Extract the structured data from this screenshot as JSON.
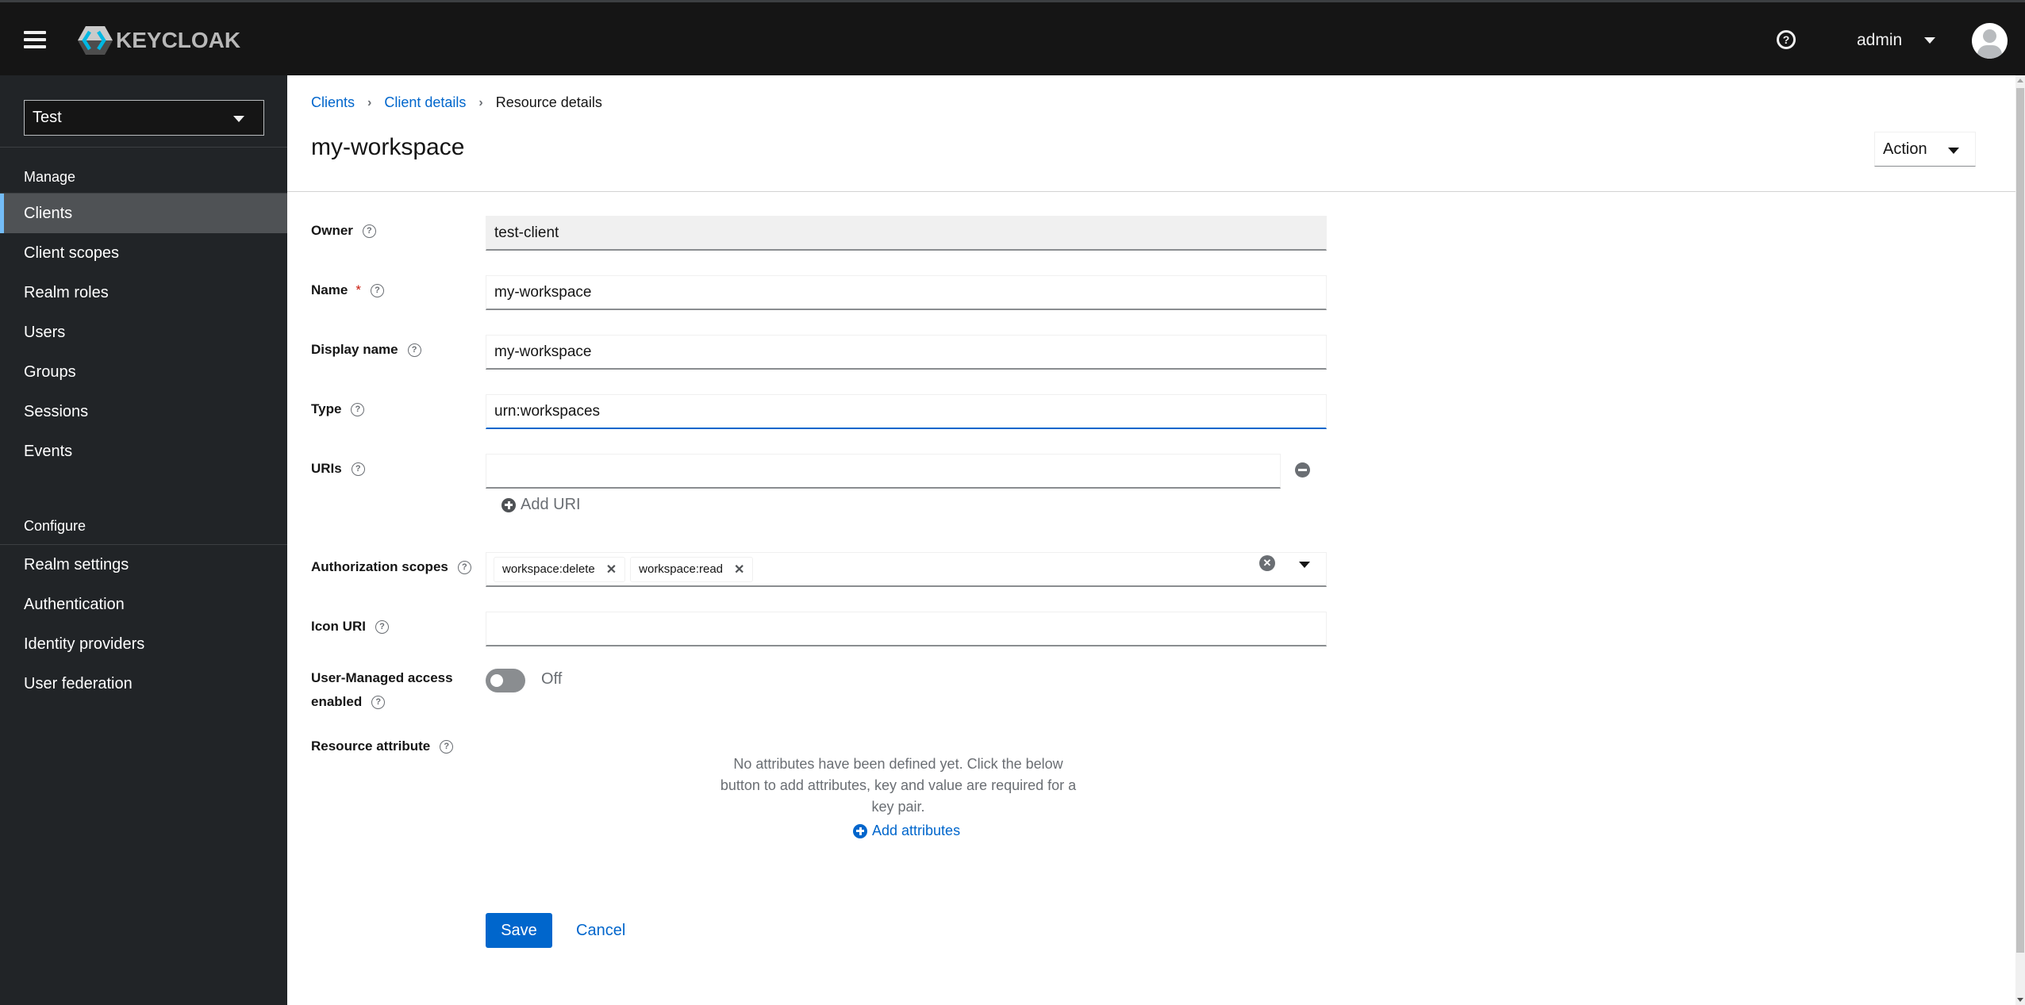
{
  "header": {
    "brand": "KEYCLOAK",
    "user_name": "admin",
    "icons": {
      "menu": "hamburger-icon",
      "help": "question-circle-icon",
      "avatar": "user-avatar-icon"
    }
  },
  "sidebar": {
    "realm": "Test",
    "sections": [
      {
        "title": "Manage",
        "items": [
          {
            "label": "Clients",
            "active": true
          },
          {
            "label": "Client scopes"
          },
          {
            "label": "Realm roles"
          },
          {
            "label": "Users"
          },
          {
            "label": "Groups"
          },
          {
            "label": "Sessions"
          },
          {
            "label": "Events"
          }
        ]
      },
      {
        "title": "Configure",
        "items": [
          {
            "label": "Realm settings"
          },
          {
            "label": "Authentication"
          },
          {
            "label": "Identity providers"
          },
          {
            "label": "User federation"
          }
        ]
      }
    ],
    "accent_color": "#73bcf7"
  },
  "breadcrumb": [
    {
      "label": "Clients",
      "link": true
    },
    {
      "label": "Client details",
      "link": true
    },
    {
      "label": "Resource details",
      "link": false
    }
  ],
  "page": {
    "title": "my-workspace",
    "action_label": "Action"
  },
  "form": {
    "owner": {
      "label": "Owner",
      "value": "test-client"
    },
    "name": {
      "label": "Name",
      "required_mark": "*",
      "value": "my-workspace"
    },
    "display_name": {
      "label": "Display name",
      "value": "my-workspace"
    },
    "type": {
      "label": "Type",
      "value": "urn:workspaces"
    },
    "uris": {
      "label": "URIs",
      "value": "",
      "add_label": "Add URI"
    },
    "authorization_scopes": {
      "label": "Authorization scopes",
      "chips": [
        "workspace:delete",
        "workspace:read"
      ]
    },
    "icon_uri": {
      "label": "Icon URI",
      "value": ""
    },
    "user_managed_access": {
      "label_line1": "User-Managed access",
      "label_line2": "enabled",
      "state": "Off",
      "enabled": false
    },
    "resource_attribute": {
      "label": "Resource attribute",
      "empty_text": "No attributes have been defined yet. Click the below button to add attributes, key and value are required for a key pair.",
      "add_label": "Add attributes"
    },
    "save_label": "Save",
    "cancel_label": "Cancel"
  },
  "colors": {
    "primary": "#0066cc",
    "masthead": "#151515",
    "sidebar": "#212427",
    "required": "#c9190b"
  }
}
